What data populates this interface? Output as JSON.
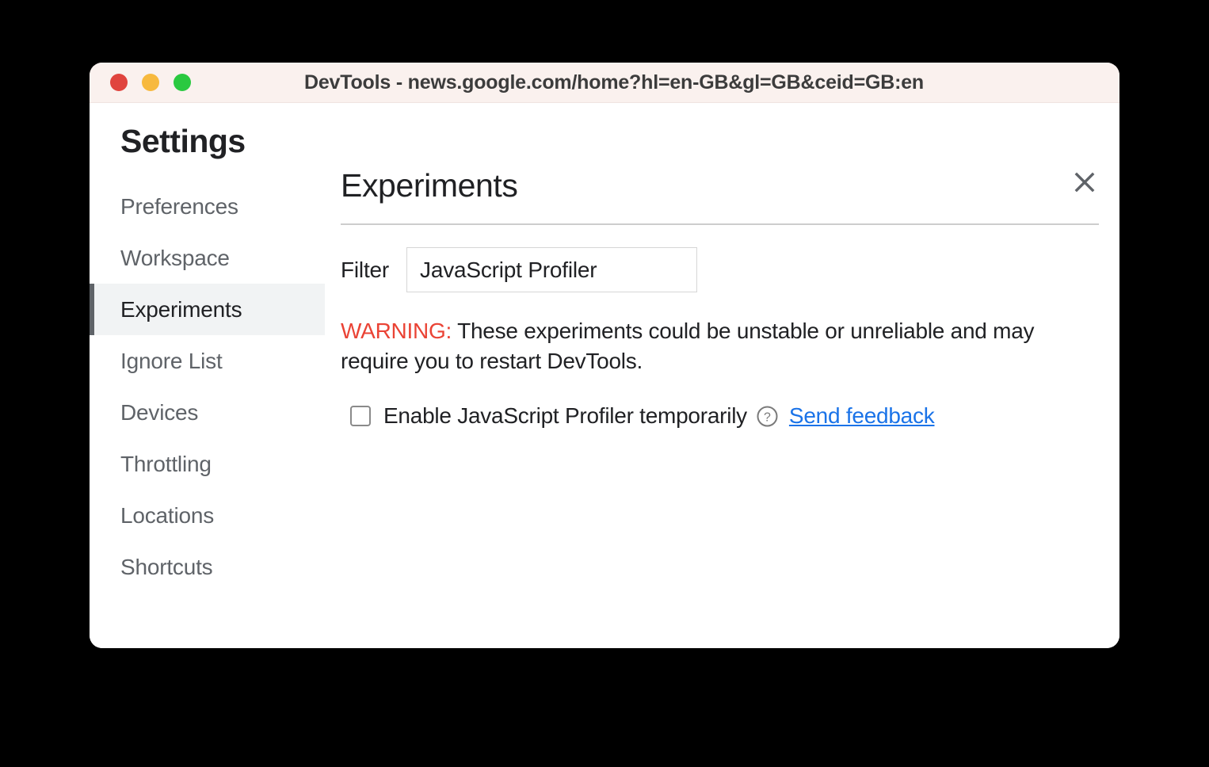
{
  "window": {
    "title": "DevTools - news.google.com/home?hl=en-GB&gl=GB&ceid=GB:en",
    "traffic_lights": [
      {
        "name": "close",
        "color": "#e0443e"
      },
      {
        "name": "minimize",
        "color": "#f7b93e"
      },
      {
        "name": "zoom",
        "color": "#2ac940"
      }
    ]
  },
  "sidebar": {
    "title": "Settings",
    "items": [
      {
        "label": "Preferences",
        "selected": false
      },
      {
        "label": "Workspace",
        "selected": false
      },
      {
        "label": "Experiments",
        "selected": true
      },
      {
        "label": "Ignore List",
        "selected": false
      },
      {
        "label": "Devices",
        "selected": false
      },
      {
        "label": "Throttling",
        "selected": false
      },
      {
        "label": "Locations",
        "selected": false
      },
      {
        "label": "Shortcuts",
        "selected": false
      }
    ]
  },
  "main": {
    "title": "Experiments",
    "close_icon": "close-icon",
    "filter": {
      "label": "Filter",
      "value": "JavaScript Profiler",
      "placeholder": ""
    },
    "warning": {
      "label": "WARNING:",
      "text": " These experiments could be unstable or unreliable and may require you to restart DevTools.",
      "color": "#ea4335"
    },
    "experiment": {
      "checked": false,
      "label": "Enable JavaScript Profiler temporarily",
      "help_icon": "help-circle-icon",
      "feedback_link": "Send feedback",
      "link_color": "#1a73e8"
    }
  }
}
